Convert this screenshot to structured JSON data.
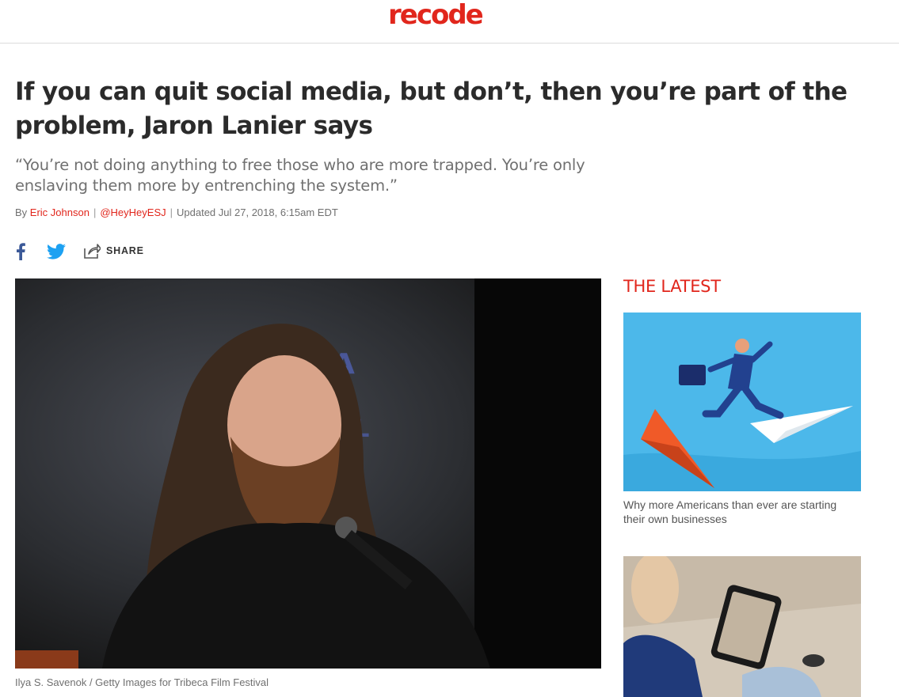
{
  "site": {
    "logo": "recode"
  },
  "article": {
    "headline": "If you can quit social media, but don’t, then you’re part of the problem, Jaron Lanier says",
    "dek": "“You’re not doing anything to free those who are more trapped. You’re only enslaving them more by entrenching the system.”",
    "byline": {
      "prefix": "By",
      "author": "Eric Johnson",
      "twitter": "@HeyHeyESJ",
      "updated": "Updated Jul 27, 2018, 6:15am EDT"
    },
    "share": {
      "label": "SHARE"
    },
    "hero_caption": "Ilya S. Savenok / Getty Images for Tribeca Film Festival"
  },
  "sidebar": {
    "title": "THE LATEST",
    "items": [
      {
        "title": "Why more Americans than ever are starting their own businesses",
        "image": "businessman-paper-plane-illustration"
      },
      {
        "title": "",
        "image": "woman-holding-tablet-photo"
      }
    ]
  },
  "colors": {
    "brand_red": "#e1261c",
    "facebook_blue": "#3b5998",
    "twitter_blue": "#1da1f2"
  }
}
